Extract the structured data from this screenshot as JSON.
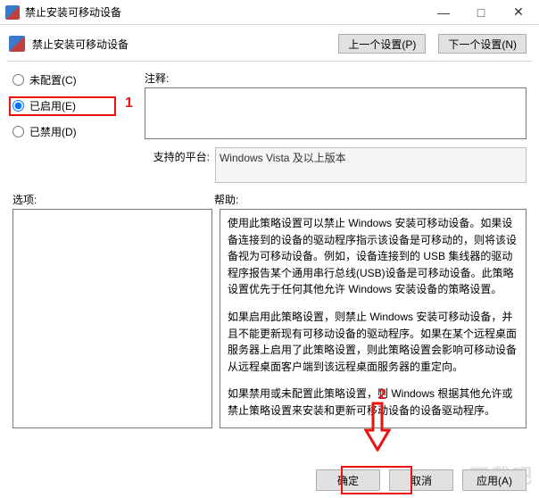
{
  "window": {
    "title": "禁止安装可移动设备"
  },
  "header": {
    "policy_name": "禁止安装可移动设备",
    "prev_btn": "上一个设置(P)",
    "next_btn": "下一个设置(N)"
  },
  "state": {
    "not_configured": "未配置(C)",
    "enabled": "已启用(E)",
    "disabled": "已禁用(D)",
    "selected": "enabled"
  },
  "fields": {
    "comment_label": "注释:",
    "comment_value": "",
    "supported_label": "支持的平台:",
    "supported_value": "Windows Vista 及以上版本"
  },
  "sections": {
    "options_label": "选项:",
    "help_label": "帮助:"
  },
  "help": {
    "p1": "使用此策略设置可以禁止 Windows 安装可移动设备。如果设备连接到的设备的驱动程序指示该设备是可移动的，则将该设备视为可移动设备。例如，设备连接到的 USB 集线器的驱动程序报告某个通用串行总线(USB)设备是可移动设备。此策略设置优先于任何其他允许 Windows 安装设备的策略设置。",
    "p2": "如果启用此策略设置，则禁止 Windows 安装可移动设备，并且不能更新现有可移动设备的驱动程序。如果在某个远程桌面服务器上启用了此策略设置，则此策略设置会影响可移动设备从远程桌面客户端到该远程桌面服务器的重定向。",
    "p3": "如果禁用或未配置此策略设置，则 Windows 根据其他允许或禁止策略设置来安装和更新可移动设备的设备驱动程序。"
  },
  "buttons": {
    "ok": "确定",
    "cancel": "取消",
    "apply": "应用(A)"
  },
  "annotations": {
    "num1": "1",
    "num2": "2"
  }
}
